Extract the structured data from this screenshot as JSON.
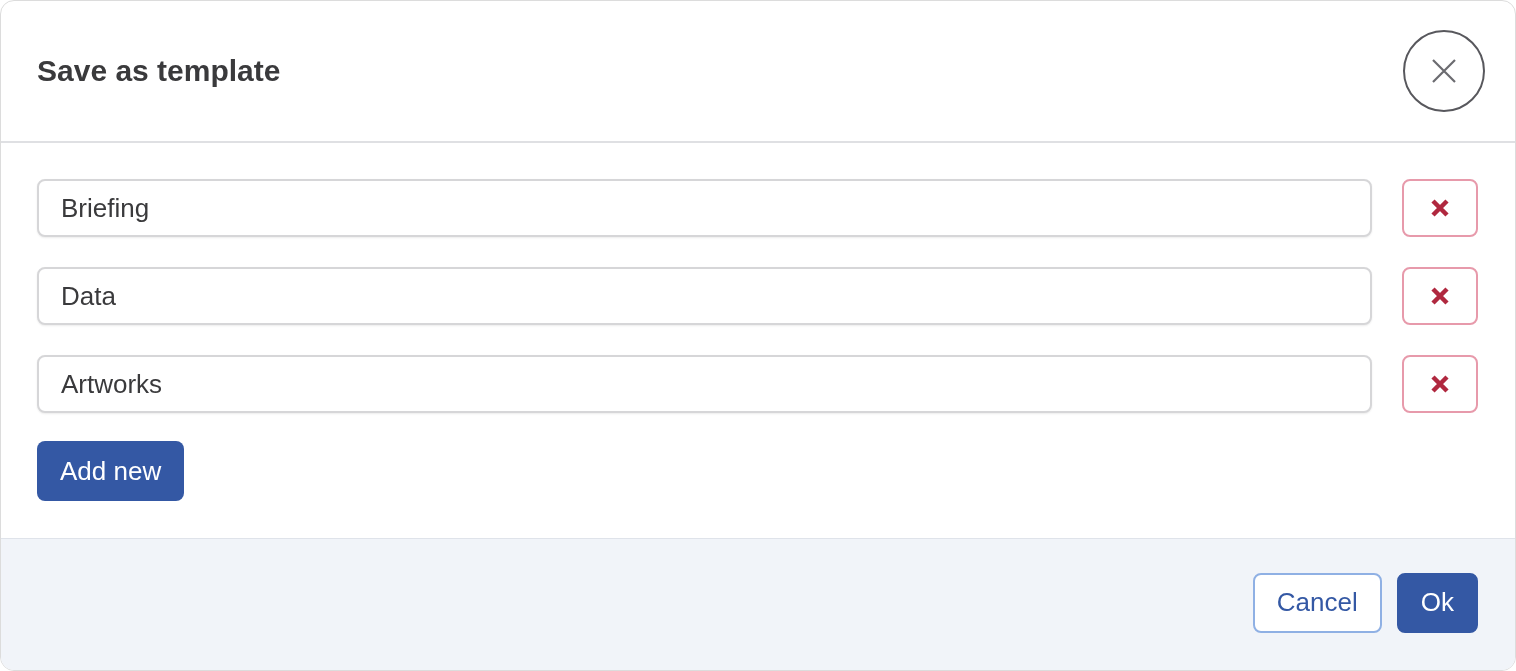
{
  "dialog": {
    "title": "Save as template"
  },
  "fields": [
    {
      "value": "Briefing"
    },
    {
      "value": "Data"
    },
    {
      "value": "Artworks"
    }
  ],
  "add_button": "Add new",
  "footer_buttons": [
    {
      "label": "Cancel",
      "kind": "secondary"
    },
    {
      "label": "Ok",
      "kind": "primary"
    }
  ]
}
